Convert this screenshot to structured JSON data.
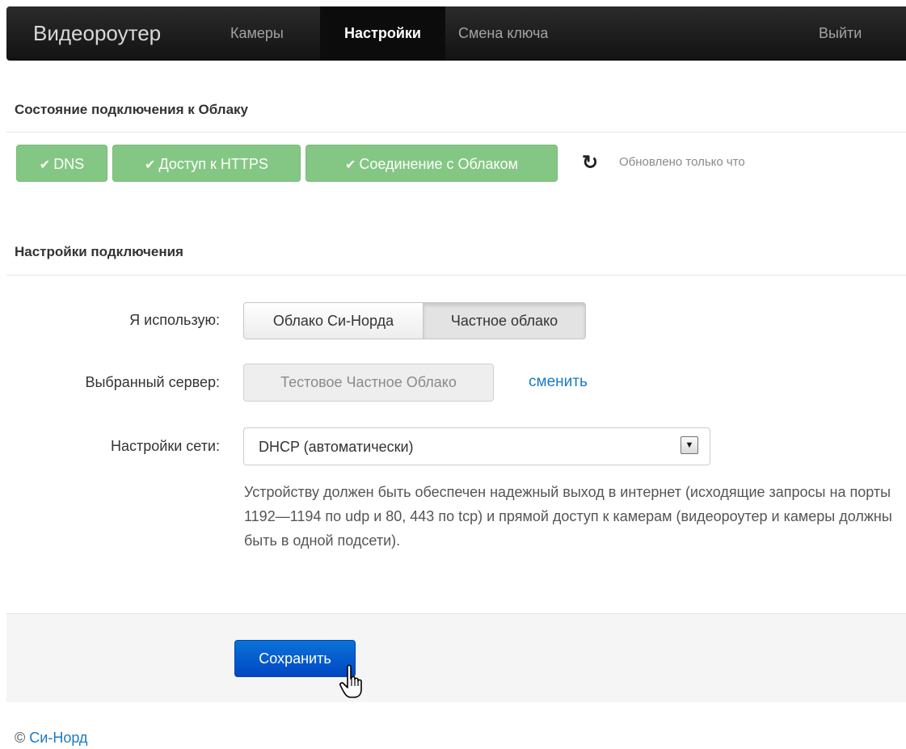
{
  "navbar": {
    "brand": "Видеороутер",
    "items": [
      {
        "label": "Камеры"
      },
      {
        "label": "Настройки"
      },
      {
        "label": "Смена ключа"
      }
    ],
    "logout": "Выйти"
  },
  "status": {
    "title": "Состояние подключения к Облаку",
    "checks": [
      "DNS",
      "Доступ к HTTPS",
      "Соединение с Облаком"
    ],
    "check_glyph": "✔",
    "refresh_glyph": "↻",
    "updated": "Обновлено только что",
    "badge_color": "#84c784"
  },
  "connection": {
    "title": "Настройки подключения",
    "use_label": "Я использую:",
    "use_options": [
      "Облако Си-Норда",
      "Частное облако"
    ],
    "use_selected": "Частное облако",
    "server_label": "Выбранный сервер:",
    "server_value": "Тестовое Частное Облако",
    "change_link": "сменить",
    "network_label": "Настройки сети:",
    "network_value": "DHCP (автоматически)",
    "help": "Устройству должен быть обеспечен надежный выход в интернет (исходящие запросы на порты 1192—1194 по udp и 80, 443 по tcp) и прямой доступ к камерам (видеороутер и камеры должны быть в одной подсети)."
  },
  "actions": {
    "save": "Сохранить"
  },
  "footer": {
    "copyright_symbol": "©",
    "company": "Си-Норд"
  }
}
